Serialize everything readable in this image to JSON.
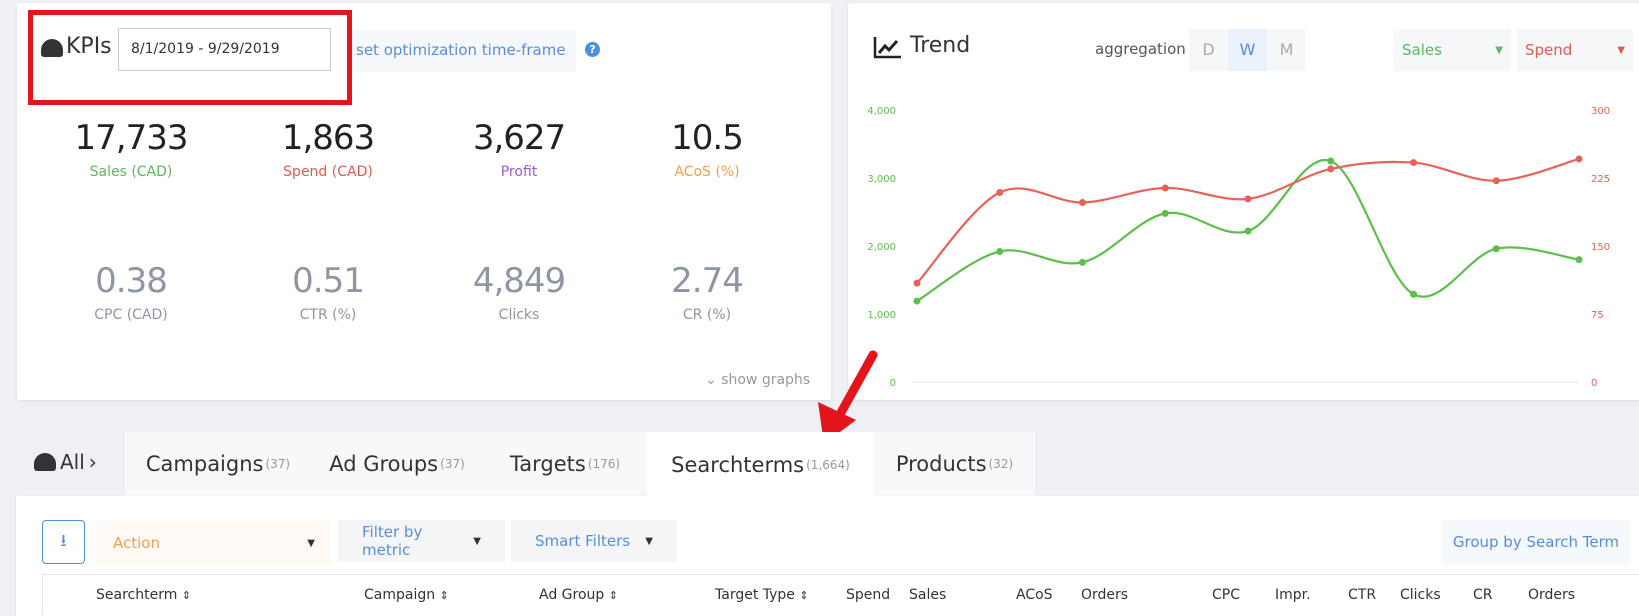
{
  "kpis": {
    "title": "KPIs",
    "date_range": "8/1/2019 - 9/29/2019",
    "optimization_link": "set optimization time-frame",
    "help_icon": "question-circle-icon",
    "primary": [
      {
        "value": "17,733",
        "label": "Sales (CAD)",
        "color": "#5cb85c"
      },
      {
        "value": "1,863",
        "label": "Spend (CAD)",
        "color": "#e05a4f"
      },
      {
        "value": "3,627",
        "label": "Profit",
        "color": "#9b59d0"
      },
      {
        "value": "10.5",
        "label": "ACoS (%)",
        "color": "#f0a050"
      }
    ],
    "secondary": [
      {
        "value": "0.38",
        "label": "CPC (CAD)"
      },
      {
        "value": "0.51",
        "label": "CTR (%)"
      },
      {
        "value": "4,849",
        "label": "Clicks"
      },
      {
        "value": "2.74",
        "label": "CR (%)"
      }
    ],
    "show_graphs": "show graphs"
  },
  "trend": {
    "title": "Trend",
    "aggregation_label": "aggregation",
    "aggregation_options": [
      "D",
      "W",
      "M"
    ],
    "aggregation_selected": "W",
    "metric_left": "Sales",
    "metric_right": "Spend"
  },
  "chart_data": {
    "type": "line",
    "x": [
      1,
      2,
      3,
      4,
      5,
      6,
      7,
      8,
      9
    ],
    "series": [
      {
        "name": "Sales",
        "axis": "left",
        "color": "#5cbf4a",
        "values": [
          1190,
          1920,
          1760,
          2480,
          2220,
          3250,
          1290,
          1960,
          1800
        ]
      },
      {
        "name": "Spend",
        "axis": "right",
        "color": "#e8625a",
        "values": [
          109,
          209,
          198,
          214,
          202,
          235,
          242,
          222,
          246
        ]
      }
    ],
    "y_left": {
      "range": [
        0,
        4000
      ],
      "ticks": [
        "0",
        "1,000",
        "2,000",
        "3,000",
        "4,000"
      ],
      "color": "#5cbf4a"
    },
    "y_right": {
      "range": [
        0,
        300
      ],
      "ticks": [
        "0",
        "75",
        "150",
        "225",
        "300"
      ],
      "color": "#e8625a"
    },
    "grid": false
  },
  "tabs": {
    "root": "All",
    "items": [
      {
        "label": "Campaigns",
        "count": "(37)"
      },
      {
        "label": "Ad Groups",
        "count": "(37)"
      },
      {
        "label": "Targets",
        "count": "(176)"
      },
      {
        "label": "Searchterms",
        "count": "(1,664)"
      },
      {
        "label": "Products",
        "count": "(32)"
      }
    ],
    "active": "Searchterms"
  },
  "toolbar": {
    "download_icon": "download-icon",
    "action": "Action",
    "filter_by_metric": "Filter by metric",
    "smart_filters": "Smart Filters",
    "group_by": "Group by Search Term"
  },
  "table": {
    "columns": [
      "Searchterm",
      "Campaign",
      "Ad Group",
      "Target Type",
      "Spend",
      "Sales",
      "ACoS",
      "Orders",
      "CPC",
      "Impr.",
      "CTR",
      "Clicks",
      "CR",
      "Orders"
    ]
  }
}
